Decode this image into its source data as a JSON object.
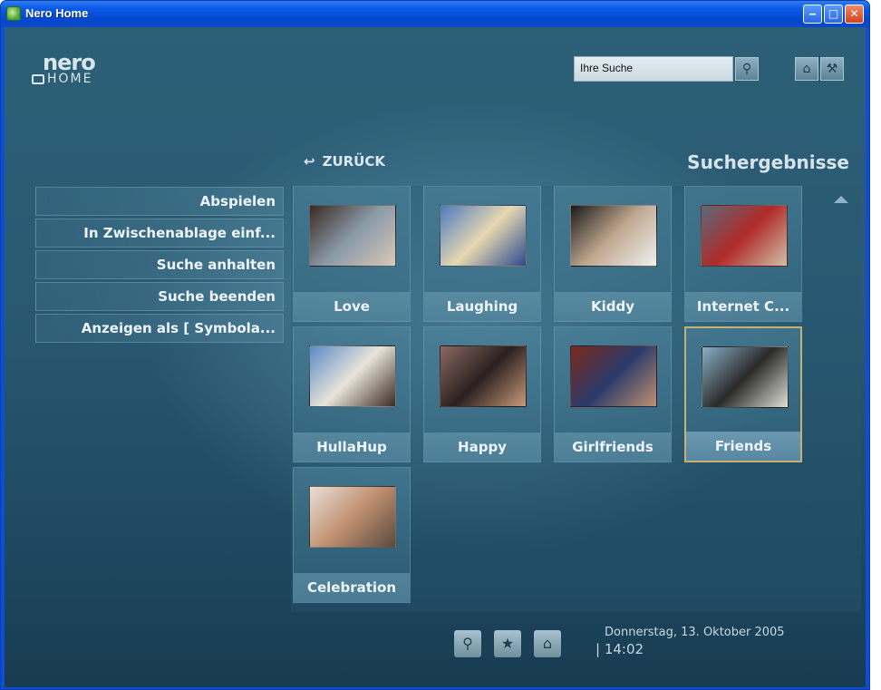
{
  "window": {
    "title": "Nero Home",
    "minimize": "‒",
    "maximize": "□",
    "close": "✕"
  },
  "logo": {
    "line1": "nero",
    "line2": "HOME"
  },
  "search": {
    "value": "Ihre Suche"
  },
  "nav": {
    "back_label": "ZURÜCK",
    "back_icon": "↩",
    "section_title": "Suchergebnisse"
  },
  "menu": {
    "items": [
      "Abspielen",
      "In Zwischenablage einf...",
      "Suche anhalten",
      "Suche beenden",
      "Anzeigen als [ Symbola..."
    ]
  },
  "results": [
    {
      "label": "Love",
      "colors": [
        "#3a2a22",
        "#8a9aa8",
        "#d8c8b8"
      ]
    },
    {
      "label": "Laughing",
      "colors": [
        "#4a7ac0",
        "#e8d8b0",
        "#2a4a90"
      ]
    },
    {
      "label": "Kiddy",
      "colors": [
        "#1a1a1a",
        "#c0a890",
        "#eef0f2"
      ]
    },
    {
      "label": "Internet C...",
      "colors": [
        "#5a6a7a",
        "#b02a2a",
        "#d0c0a8"
      ]
    },
    {
      "label": "HullaHup",
      "colors": [
        "#5a8ac8",
        "#e8e4d8",
        "#3a2a20"
      ]
    },
    {
      "label": "Happy",
      "colors": [
        "#8a6a60",
        "#2a2020",
        "#c89a7a"
      ]
    },
    {
      "label": "Girlfriends",
      "colors": [
        "#7a2a1a",
        "#2a3a6a",
        "#c09070"
      ]
    },
    {
      "label": "Friends",
      "colors": [
        "#8ab0c8",
        "#2a2a2a",
        "#e0e0d8"
      ]
    },
    {
      "label": "Celebration",
      "colors": [
        "#e8e0d8",
        "#c09070",
        "#5a4a40"
      ]
    }
  ],
  "selected_result": "Friends",
  "bottom": {
    "icons": [
      "search-folder-icon",
      "favorites-folder-icon",
      "home-icon"
    ],
    "date": "Donnerstag, 13. Oktober 2005",
    "time": "| 14:02"
  }
}
